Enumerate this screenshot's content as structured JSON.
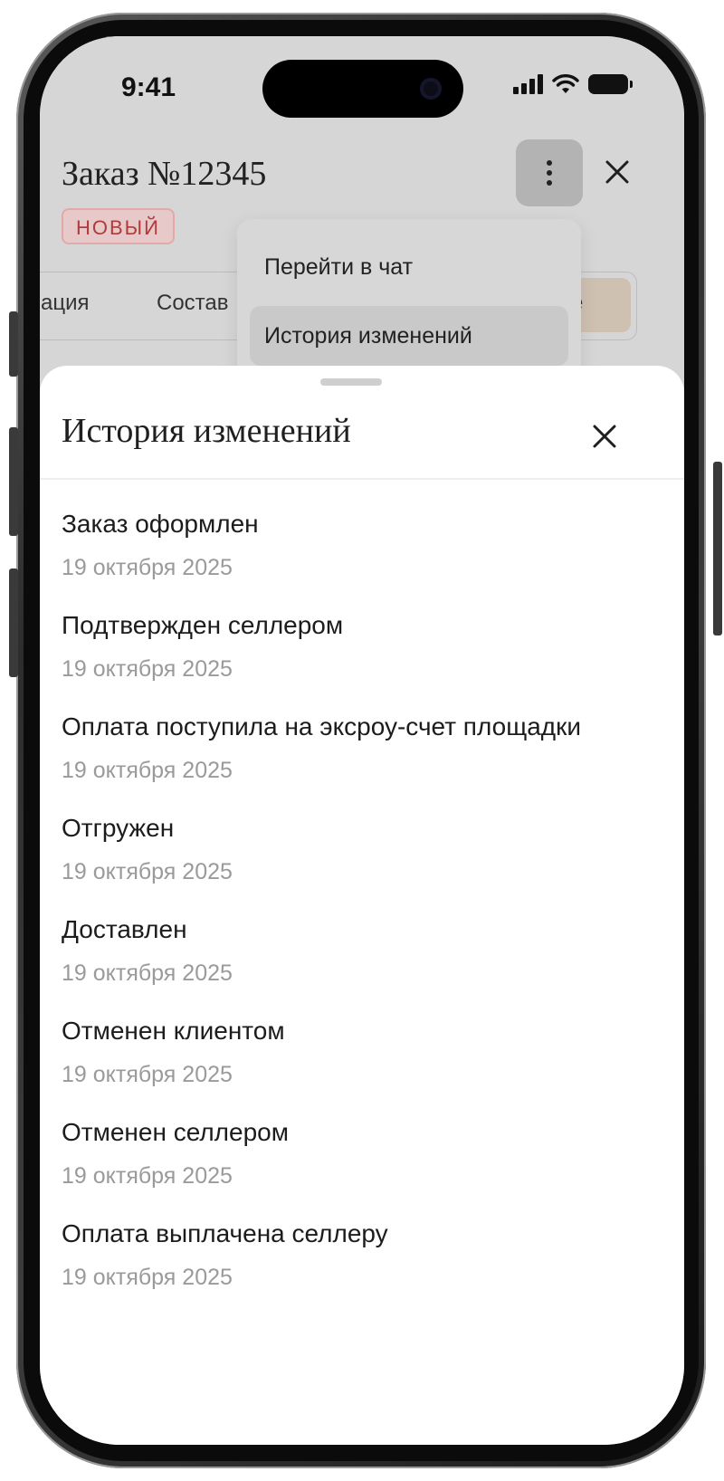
{
  "status_bar": {
    "time": "9:41"
  },
  "order": {
    "title": "Заказ №12345",
    "badge": "НОВЫЙ"
  },
  "tabs": {
    "items": [
      "ация",
      "Состав"
    ],
    "active_partial": "ле"
  },
  "dropdown": {
    "items": [
      "Перейти в чат",
      "История изменений"
    ]
  },
  "sheet": {
    "title": "История изменений",
    "history": [
      {
        "title": "Заказ оформлен",
        "date": "19 октября 2025"
      },
      {
        "title": "Подтвержден селлером",
        "date": "19 октября 2025"
      },
      {
        "title": "Оплата поступила на эксроу-счет площадки",
        "date": "19 октября 2025"
      },
      {
        "title": "Отгружен",
        "date": "19 октября 2025"
      },
      {
        "title": "Доставлен",
        "date": "19 октября 2025"
      },
      {
        "title": "Отменен клиентом",
        "date": "19 октября 2025"
      },
      {
        "title": "Отменен селлером",
        "date": "19 октября 2025"
      },
      {
        "title": "Оплата выплачена селлеру",
        "date": "19 октября 2025"
      }
    ]
  },
  "colors": {
    "badge_text": "#b23a3a",
    "badge_bg": "#e8c9c9",
    "active_tab_bg": "#cfc1b2",
    "dim_bg": "#d6d6d6",
    "date_text": "#9a9a9a"
  },
  "icons": {
    "more": "more-vertical-icon",
    "close": "close-icon"
  }
}
